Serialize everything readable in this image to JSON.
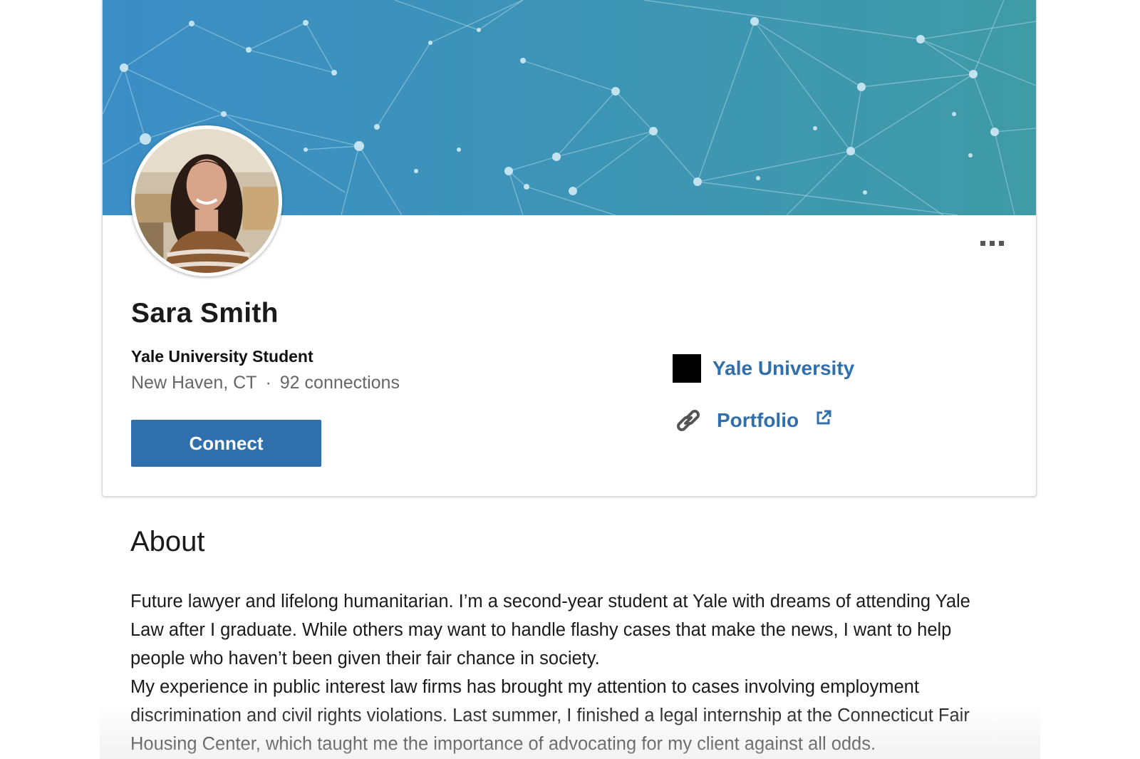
{
  "profile": {
    "name": "Sara Smith",
    "headline": "Yale University Student",
    "location": "New Haven, CT",
    "separator": "·",
    "connections": "92 connections",
    "connect_label": "Connect",
    "more_icon": "more-horizontal-icon"
  },
  "sidebar_links": {
    "school_label": "Yale University",
    "school_icon": "school-logo-icon",
    "portfolio_label": "Portfolio",
    "portfolio_icon": "link-icon",
    "external_icon": "external-link-icon"
  },
  "about": {
    "title": "About",
    "paragraph_1": "Future lawyer and lifelong humanitarian. I’m a second-year student at Yale with dreams of attending Yale Law after I graduate. While others may want to handle flashy cases that make the news, I want to help people who haven’t been given their fair chance in society.",
    "paragraph_2": "My experience in public interest law firms has brought my attention to cases involving employment discrimination and civil rights violations. Last summer, I finished a legal internship at the Connecticut Fair Housing Center, which taught me the importance of advocating for my client against all odds."
  },
  "colors": {
    "accent": "#2f6fab",
    "banner_left": "#3c8fc4",
    "banner_right": "#3d9aa8"
  }
}
